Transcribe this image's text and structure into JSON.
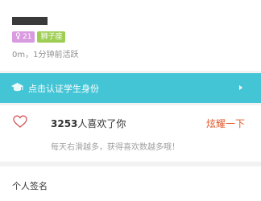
{
  "profile": {
    "gender_icon": "female-icon",
    "age": "21",
    "zodiac": "狮子座",
    "activity": "0m，1分钟前活跃",
    "colors": {
      "gender_tag": "#d99be0",
      "zodiac_tag": "#9fce54"
    }
  },
  "student_banner": {
    "icon": "graduation-cap-icon",
    "label": "点击认证学生身份",
    "color": "#44c5d6"
  },
  "likes": {
    "icon": "heart-outline-icon",
    "count": "3253",
    "suffix": "人喜欢了你",
    "action_label": "炫耀一下",
    "hint": "每天右滑越多，获得喜欢数越多哦！",
    "action_color": "#e05a2d"
  },
  "signature": {
    "label": "个人签名"
  }
}
